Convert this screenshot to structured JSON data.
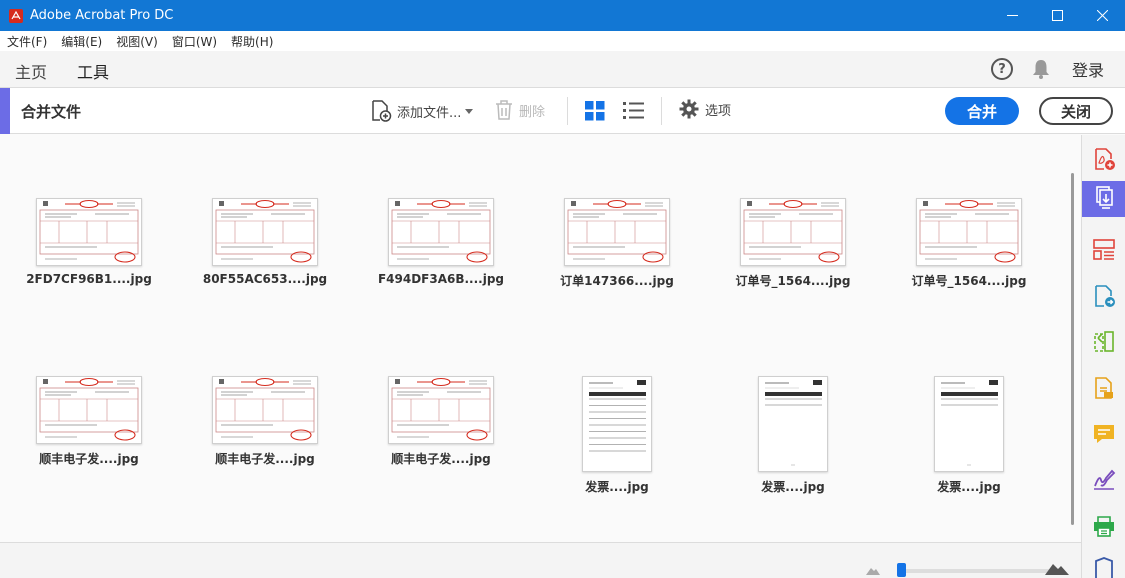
{
  "window": {
    "title": "Adobe Acrobat Pro DC"
  },
  "menu": [
    "文件(F)",
    "编辑(E)",
    "视图(V)",
    "窗口(W)",
    "帮助(H)"
  ],
  "nav": {
    "tabs": [
      "主页",
      "工具"
    ],
    "active_tab": "工具",
    "help_label": "?",
    "login_label": "登录"
  },
  "toolbar": {
    "title": "合并文件",
    "add_files_label": "添加文件...",
    "delete_label": "删除",
    "options_label": "选项",
    "merge_label": "合并",
    "close_label": "关闭"
  },
  "files": [
    {
      "name": "2FD7CF96B1....jpg",
      "kind": "invoice"
    },
    {
      "name": "80F55AC653....jpg",
      "kind": "invoice"
    },
    {
      "name": "F494DF3A6B....jpg",
      "kind": "invoice"
    },
    {
      "name": "订单147366....jpg",
      "kind": "invoice"
    },
    {
      "name": "订单号_1564....jpg",
      "kind": "invoice"
    },
    {
      "name": "订单号_1564....jpg",
      "kind": "invoice"
    },
    {
      "name": "顺丰电子发....jpg",
      "kind": "invoice"
    },
    {
      "name": "顺丰电子发....jpg",
      "kind": "invoice"
    },
    {
      "name": "顺丰电子发....jpg",
      "kind": "invoice"
    },
    {
      "name": "发票....jpg",
      "kind": "document"
    },
    {
      "name": "发票....jpg",
      "kind": "document"
    },
    {
      "name": "发票....jpg",
      "kind": "document"
    }
  ],
  "right_panel_icons": [
    "create-pdf-icon",
    "combine-files-icon",
    "organize-pages-icon",
    "export-pdf-icon",
    "compare-icon",
    "edit-pdf-icon",
    "comment-icon",
    "fill-sign-icon",
    "print-production-icon",
    "protect-icon"
  ],
  "colors": {
    "titlebar": "#1277d4",
    "accent": "#6c6ce6",
    "primary_button": "#1473e6",
    "stamp_red": "#d52b1e"
  }
}
